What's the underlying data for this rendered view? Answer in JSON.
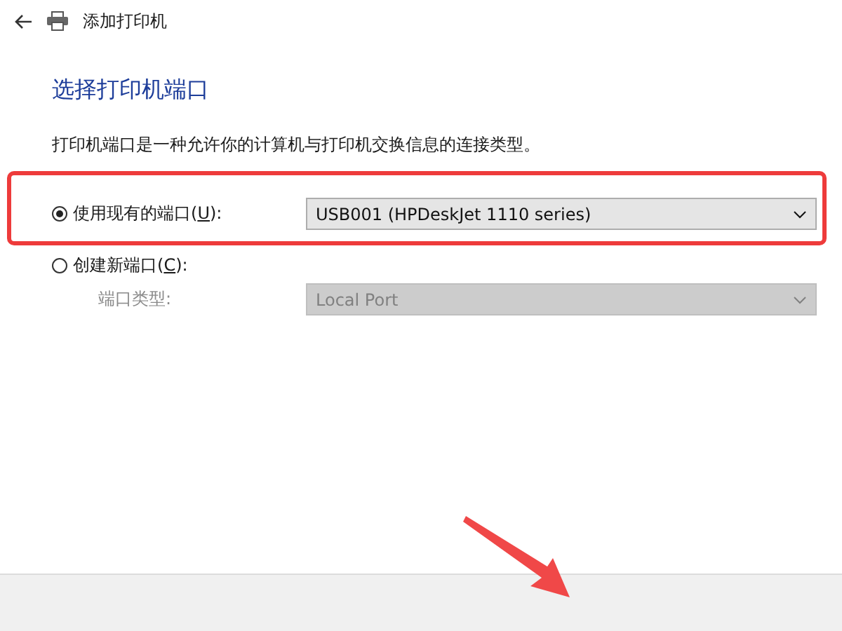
{
  "window": {
    "title": "添加打印机"
  },
  "heading": "选择打印机端口",
  "description": "打印机端口是一种允许你的计算机与打印机交换信息的连接类型。",
  "options": [
    {
      "label_parts": [
        "使用现有的端口(",
        "U",
        "):"
      ],
      "selected": true,
      "highlighted": true,
      "dropdown": {
        "value": "USB001 (HPDeskJet 1110 series)",
        "disabled": false
      }
    },
    {
      "label_parts": [
        "创建新端口(",
        "C",
        "):"
      ],
      "selected": false,
      "highlighted": false,
      "sub_label": "端口类型:",
      "dropdown": {
        "value": "Local Port",
        "disabled": true
      }
    }
  ],
  "annotation_arrow": true
}
